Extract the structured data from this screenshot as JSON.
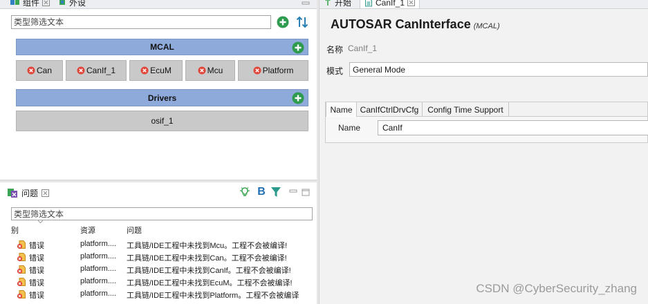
{
  "left_view": {
    "tabs": [
      {
        "label": "组件"
      },
      {
        "label": "外设"
      }
    ]
  },
  "components": {
    "filter_placeholder": "类型筛选文本",
    "groups": [
      {
        "title": "MCAL",
        "items": [
          {
            "label": "Can",
            "icon": "error-circle-icon"
          },
          {
            "label": "CanIf_1",
            "icon": "error-circle-icon"
          },
          {
            "label": "EcuM",
            "icon": "error-circle-icon"
          },
          {
            "label": "Mcu",
            "icon": "error-circle-icon"
          },
          {
            "label": "Platform",
            "icon": "error-circle-icon"
          }
        ]
      },
      {
        "title": "Drivers",
        "items": [
          {
            "label": "osif_1"
          }
        ]
      }
    ]
  },
  "problems": {
    "tab_label": "问题",
    "toolbar_bold_label": "B",
    "filter_placeholder": "类型筛选文本",
    "columns": [
      "别",
      "资源",
      "问题"
    ],
    "rows": [
      {
        "severity": "错误",
        "resource": "platform....",
        "message": "工具链/IDE工程中未找到Mcu。工程不会被编译!"
      },
      {
        "severity": "错误",
        "resource": "platform....",
        "message": "工具链/IDE工程中未找到Can。工程不会被编译!"
      },
      {
        "severity": "错误",
        "resource": "platform....",
        "message": "工具链/IDE工程中未找到CanIf。工程不会被编译!"
      },
      {
        "severity": "错误",
        "resource": "platform....",
        "message": "工具链/IDE工程中未找到EcuM。工程不会被编译!"
      },
      {
        "severity": "错误",
        "resource": "platform....",
        "message": "工具链/IDE工程中未找到Platform。工程不会被编译"
      }
    ]
  },
  "editor": {
    "tabs": [
      {
        "label": "开始"
      },
      {
        "label": "CanIf_1"
      }
    ],
    "title": "AUTOSAR CanInterface",
    "subtitle": "(MCAL)",
    "name_label": "名称",
    "name_value": "CanIf_1",
    "mode_label": "模式",
    "mode_value": "General Mode",
    "sub_tabs": [
      "Name",
      "CanIfCtrlDrvCfg",
      "Config Time Support"
    ],
    "field_label": "Name",
    "field_value": "CanIf"
  },
  "watermark": "CSDN @CyberSecurity_zhang",
  "colors": {
    "group_header": "#8eaadb",
    "component_bg": "#c9c9c9",
    "add_green": "#2e9b4e",
    "error_red": "#e0453a",
    "watermark": "#9b9b9b"
  },
  "icons": {
    "add": "plus-circle-icon",
    "sort": "sort-icon",
    "error": "error-circle-icon",
    "problem_marker": "error-marker-icon",
    "hint": "lightbulb-icon",
    "filter": "filter-icon"
  }
}
